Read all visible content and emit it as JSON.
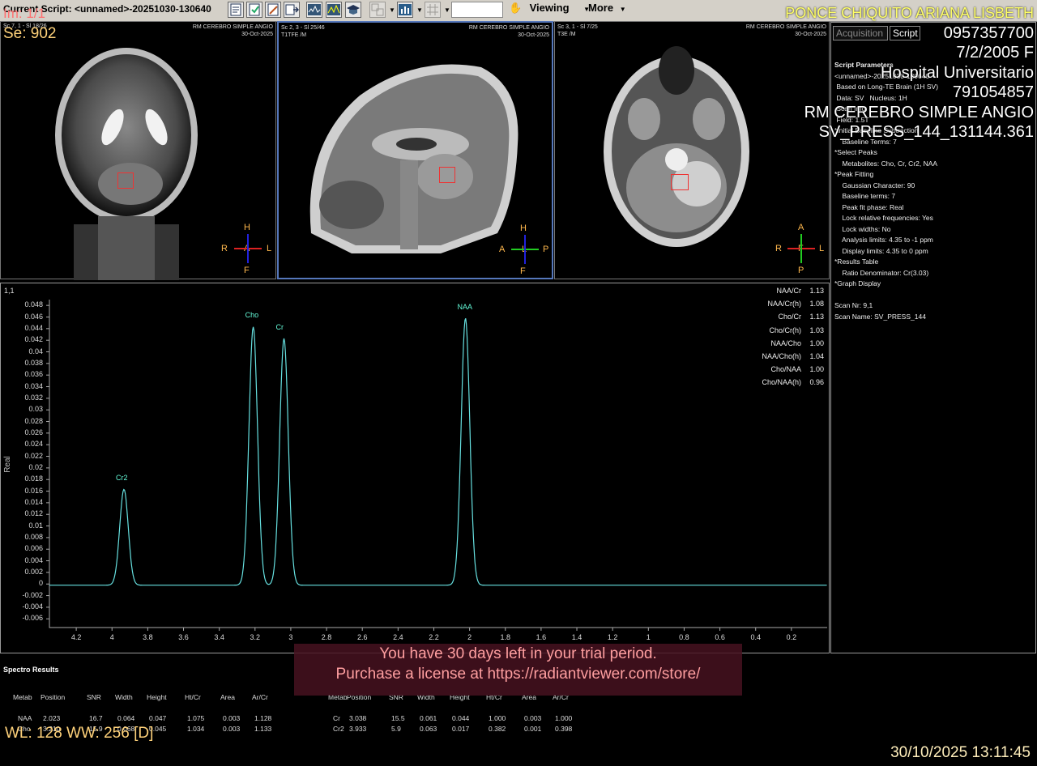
{
  "toolbar": {
    "script_title": "Current Script: <unnamed>-20251030-130640",
    "viewing_label": "Viewing",
    "more_label": "More"
  },
  "overlay": {
    "image_index": "Im: 1/1",
    "series": "Se: 902",
    "wl_ww": "WL: 128 WW: 256 [D]",
    "datetime": "30/10/2025 13:11:45"
  },
  "patient": {
    "name": "PONCE CHIQUITO ARIANA LISBETH",
    "id": "0957357700",
    "dob_sex": "7/2/2005 F",
    "institution": "Hospital Universitario",
    "accession": "791054857",
    "study": "RM CEREBRO SIMPLE ANGIO",
    "series_desc": "SV_PRESS_144_131144.361"
  },
  "viewports": [
    {
      "info": "Sc 7, 1 - Sl 18/26",
      "study": "RM CEREBRO SIMPLE ANGIO",
      "date": "30-Oct-2025",
      "seq": "",
      "ori": {
        "top": "H",
        "left": "R",
        "center": "A",
        "right": "L",
        "bottom": "F"
      }
    },
    {
      "info": "Sc 2, 3 - Sl 25/46",
      "study": "RM CEREBRO SIMPLE ANGIO",
      "date": "30-Oct-2025",
      "seq": "T1TFE  /M",
      "ori": {
        "top": "H",
        "left": "A",
        "center": "L",
        "right": "P",
        "bottom": "F"
      }
    },
    {
      "info": "Sc 3, 1 - Sl 7/25",
      "study": "RM CEREBRO SIMPLE ANGIO",
      "date": "30-Oct-2025",
      "seq": "T3E  /M",
      "ori": {
        "top": "A",
        "left": "R",
        "center": "F",
        "right": "L",
        "bottom": "P"
      }
    }
  ],
  "right_panel": {
    "tabs": [
      "Acquisition",
      "Script"
    ],
    "active_tab": "Script",
    "params": [
      "Script Parameters",
      "<unnamed>-20251030-130640",
      " Based on Long-TE Brain (1H SV)",
      " Data: SV   Nucleus: 1H",
      " Scan Info",
      " Field: 1.5T",
      "*Initial Baseline Subtraction",
      "    Baseline Terms: 7",
      "*Select Peaks",
      "    Metabolites: Cho, Cr, Cr2, NAA",
      "*Peak Fitting",
      "    Gaussian Character: 90",
      "    Baseline terms: 7",
      "    Peak fit phase: Real",
      "    Lock relative frequencies: Yes",
      "    Lock widths: No",
      "    Analysis limits: 4.35 to -1 ppm",
      "    Display limits: 4.35 to 0 ppm",
      "*Results Table",
      "    Ratio Denominator: Cr(3.03)",
      "*Graph Display",
      "",
      "Scan Nr: 9,1",
      "Scan Name: SV_PRESS_144"
    ]
  },
  "spectrum": {
    "corner": "1,1",
    "ylabel": "Real",
    "line_color": "#66e0e0",
    "ratios": [
      {
        "label": "NAA/Cr",
        "value": "1.13"
      },
      {
        "label": "NAA/Cr(h)",
        "value": "1.08"
      },
      {
        "label": "Cho/Cr",
        "value": "1.13"
      },
      {
        "label": "Cho/Cr(h)",
        "value": "1.03"
      },
      {
        "label": "NAA/Cho",
        "value": "1.00"
      },
      {
        "label": "NAA/Cho(h)",
        "value": "1.04"
      },
      {
        "label": "Cho/NAA",
        "value": "1.00"
      },
      {
        "label": "Cho/NAA(h)",
        "value": "0.96"
      }
    ]
  },
  "chart_data": {
    "type": "line",
    "xlabel": "",
    "ylabel": "Real",
    "xlim": [
      4.35,
      0
    ],
    "ylim": [
      -0.0075,
      0.049
    ],
    "x_ticks": [
      "4.2",
      "4",
      "3.8",
      "3.6",
      "3.4",
      "3.2",
      "3",
      "2.8",
      "2.6",
      "2.4",
      "2.2",
      "2",
      "1.8",
      "1.6",
      "1.4",
      "1.2",
      "1",
      "0.8",
      "0.6",
      "0.4",
      "0.2"
    ],
    "y_ticks": [
      "0.048",
      "0.046",
      "0.044",
      "0.042",
      "0.04",
      "0.038",
      "0.036",
      "0.034",
      "0.032",
      "0.03",
      "0.028",
      "0.026",
      "0.024",
      "0.022",
      "0.02",
      "0.018",
      "0.016",
      "0.014",
      "0.012",
      "0.01",
      "0.008",
      "0.006",
      "0.004",
      "0.002",
      "0",
      "-0.002",
      "-0.004",
      "-0.006"
    ],
    "peaks": [
      {
        "name": "Cr2",
        "ppm": 3.933,
        "height": 0.0165
      },
      {
        "name": "Cho",
        "ppm": 3.21,
        "height": 0.0445
      },
      {
        "name": "Cr",
        "ppm": 3.038,
        "height": 0.0425
      },
      {
        "name": "NAA",
        "ppm": 2.023,
        "height": 0.046
      }
    ]
  },
  "results": {
    "title": "Spectro Results",
    "headers": [
      "Metab",
      "Position",
      "SNR",
      "Width",
      "Height",
      "Ht/Cr",
      "Area",
      "Ar/Cr"
    ],
    "left_rows": [
      [
        "NAA",
        "2.023",
        "16.7",
        "0.064",
        "0.047",
        "1.075",
        "0.003",
        "1.128"
      ],
      [
        "Cho",
        "3.210",
        "15.9",
        "0.068",
        "0.045",
        "1.034",
        "0.003",
        "1.133"
      ]
    ],
    "right_rows": [
      [
        "Cr",
        "3.038",
        "15.5",
        "0.061",
        "0.044",
        "1.000",
        "0.003",
        "1.000"
      ],
      [
        "Cr2",
        "3.933",
        "5.9",
        "0.063",
        "0.017",
        "0.382",
        "0.001",
        "0.398"
      ]
    ]
  },
  "trial": {
    "line1": "You have 30 days left in your trial period.",
    "line2": "Purchase a license at https://radiantviewer.com/store/"
  }
}
